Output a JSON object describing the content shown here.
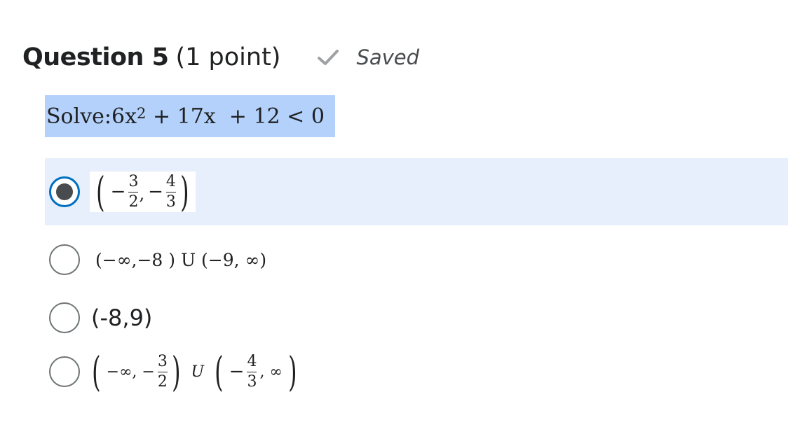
{
  "question": {
    "title": "Question 5",
    "points": "(1 point)",
    "saved_label": "Saved"
  },
  "prompt": {
    "label": "Solve:",
    "lhs_base": "6x",
    "lhs_exp": "2",
    "rest": " + 17x  + 12 < 0"
  },
  "options": [
    {
      "selected": true,
      "parts": {
        "minus1": "−",
        "n1": "3",
        "d1": "2",
        "comma": ",",
        "minus2": "−",
        "n2": "4",
        "d2": "3"
      }
    },
    {
      "selected": false,
      "text": "(−∞,−8 ) U (−9, ∞)"
    },
    {
      "selected": false,
      "text": "(-8,9)"
    },
    {
      "selected": false,
      "parts": {
        "left": "−∞, −",
        "n1": "3",
        "d1": "2",
        "union": "U",
        "minus2": "−",
        "n2": "4",
        "d2": "3",
        "right": ", ∞"
      }
    }
  ],
  "icons": {
    "saved": "check-icon",
    "radio_checked": "radio-checked-icon",
    "radio_unchecked": "radio-unchecked-icon"
  },
  "colors": {
    "prompt_highlight": "#b3d1fb",
    "selected_row": "#e6effb",
    "radio_focus": "#006fbf"
  }
}
